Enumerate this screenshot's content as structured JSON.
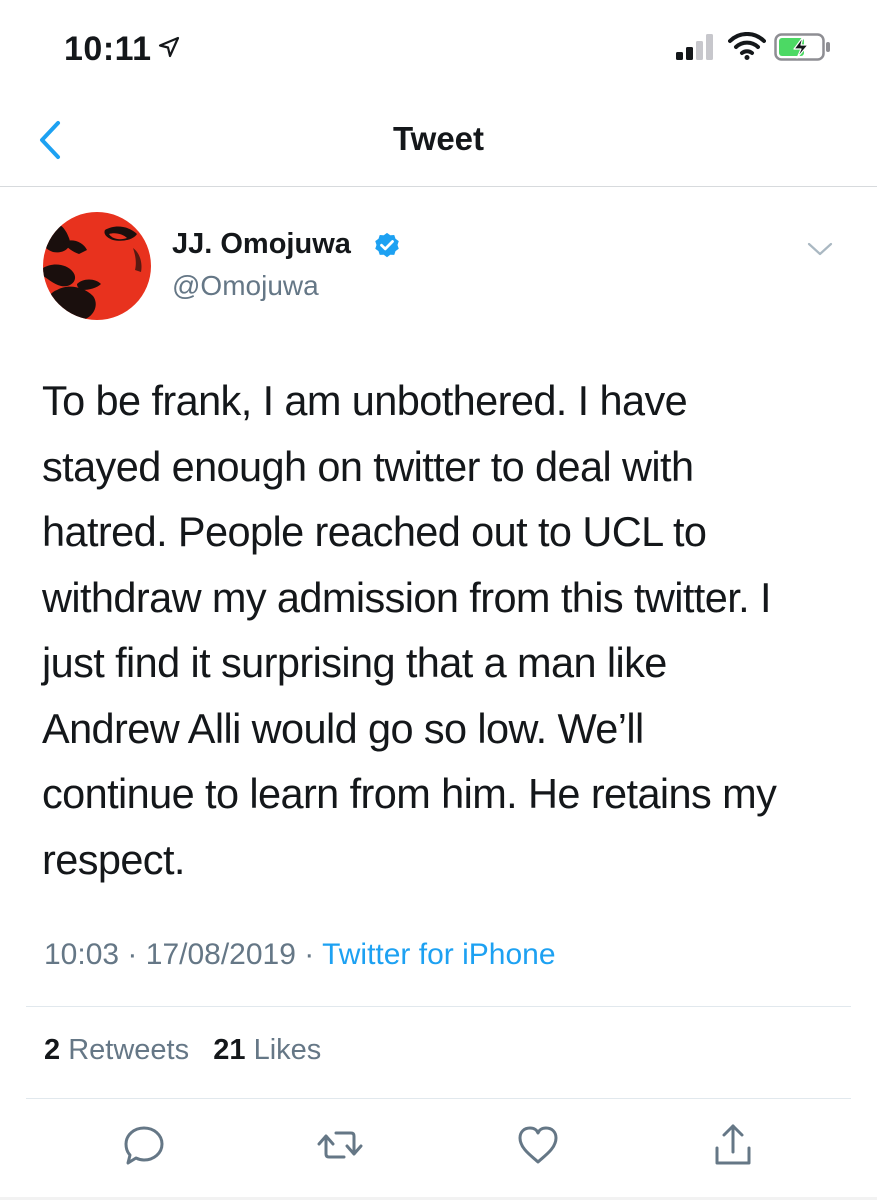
{
  "status_bar": {
    "time": "10:11",
    "icons": [
      "location-arrow-icon",
      "cellular-signal-icon",
      "wifi-icon",
      "battery-charging-icon"
    ]
  },
  "nav": {
    "title": "Tweet",
    "back_icon": "chevron-left-icon"
  },
  "tweet": {
    "author": {
      "name": "JJ. Omojuwa",
      "handle": "@Omojuwa",
      "verified": true
    },
    "lines": [
      "To be frank, I am unbothered. I have",
      "stayed enough on twitter to deal with",
      "hatred. People reached out to UCL to",
      "withdraw my admission from this twitter. I",
      "just find it surprising that a man like",
      "Andrew Alli would go so low. We’ll",
      "continue to learn from him. He retains my",
      "respect."
    ],
    "time": "10:03",
    "date": "17/08/2019",
    "separator": "·",
    "source": "Twitter for iPhone",
    "retweets_count": "2",
    "retweets_label": "Retweets",
    "likes_count": "21",
    "likes_label": "Likes"
  },
  "actions": [
    "reply-icon",
    "retweet-icon",
    "like-icon",
    "share-icon"
  ],
  "colors": {
    "accent": "#1da1f2",
    "text": "#14171a",
    "secondary": "#657786",
    "divider": "#e1e8ed",
    "battery_green": "#4cd964"
  }
}
